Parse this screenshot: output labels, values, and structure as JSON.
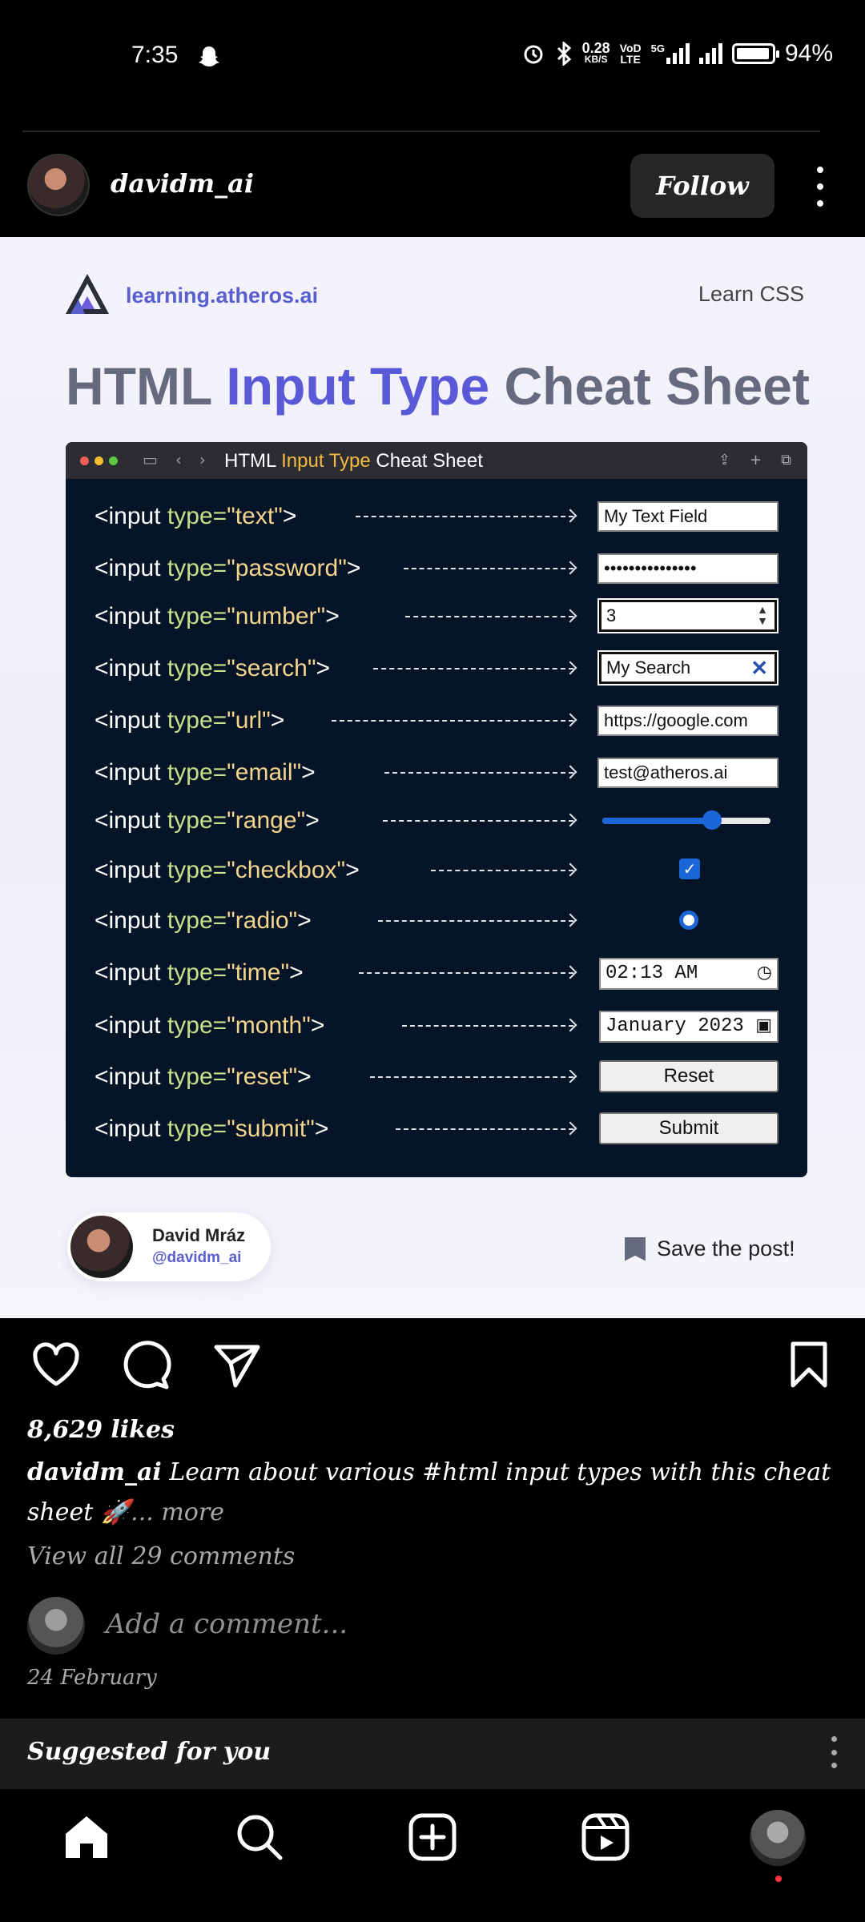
{
  "status_bar": {
    "time": "7:35",
    "net_speed_value": "0.28",
    "net_speed_unit": "KB/S",
    "volte_top": "VoD",
    "volte_bottom": "LTE",
    "network": "5G",
    "battery": "94%"
  },
  "post": {
    "username": "davidm_ai",
    "follow_label": "Follow",
    "image": {
      "brand": "learning.atheros.ai",
      "learn_link": "Learn CSS",
      "title_part1": "HTML ",
      "title_part2": "Input Type",
      "title_part3": " Cheat Sheet",
      "window_title_part1": "HTML ",
      "window_title_part2": "Input Type",
      "window_title_part3": " Cheat Sheet",
      "rows": [
        {
          "tag": "<input ",
          "attr": "type=",
          "value": "\"text\"",
          "end": ">",
          "control": "My Text Field"
        },
        {
          "tag": "<input ",
          "attr": "type=",
          "value": "\"password\"",
          "end": ">",
          "control": "•••••••••••••••"
        },
        {
          "tag": "<input ",
          "attr": "type=",
          "value": "\"number\"",
          "end": ">",
          "control": "3"
        },
        {
          "tag": "<input ",
          "attr": "type=",
          "value": "\"search\"",
          "end": ">",
          "control": "My Search"
        },
        {
          "tag": "<input ",
          "attr": "type=",
          "value": "\"url\"",
          "end": ">",
          "control": "https://google.com"
        },
        {
          "tag": "<input ",
          "attr": "type=",
          "value": "\"email\"",
          "end": ">",
          "control": "test@atheros.ai"
        },
        {
          "tag": "<input ",
          "attr": "type=",
          "value": "\"range\"",
          "end": ">",
          "control": ""
        },
        {
          "tag": "<input ",
          "attr": "type=",
          "value": "\"checkbox\"",
          "end": ">",
          "control": ""
        },
        {
          "tag": "<input ",
          "attr": "type=",
          "value": "\"radio\"",
          "end": ">",
          "control": ""
        },
        {
          "tag": "<input ",
          "attr": "type=",
          "value": "\"time\"",
          "end": ">",
          "control": "02:13 AM"
        },
        {
          "tag": "<input ",
          "attr": "type=",
          "value": "\"month\"",
          "end": ">",
          "control": "January 2023"
        },
        {
          "tag": "<input ",
          "attr": "type=",
          "value": "\"reset\"",
          "end": ">",
          "control": "Reset"
        },
        {
          "tag": "<input ",
          "attr": "type=",
          "value": "\"submit\"",
          "end": ">",
          "control": "Submit"
        }
      ],
      "range_value": 0.65,
      "author_name": "David Mráz",
      "author_handle": "@davidm_ai",
      "save_label": "Save the post!"
    },
    "likes": "8,629 likes",
    "caption_user": "davidm_ai",
    "caption_text": " Learn about various #html input types with this cheat sheet 🚀",
    "caption_more": "... more",
    "view_comments": "View all 29 comments",
    "add_comment_placeholder": "Add a comment...",
    "date": "24 February"
  },
  "suggested": {
    "label": "Suggested for you"
  },
  "colors": {
    "accent_purple": "#5a5ad8",
    "keyword_green": "#c8e08a",
    "string_yellow": "#f4d58d",
    "window_bg": "#061427"
  }
}
